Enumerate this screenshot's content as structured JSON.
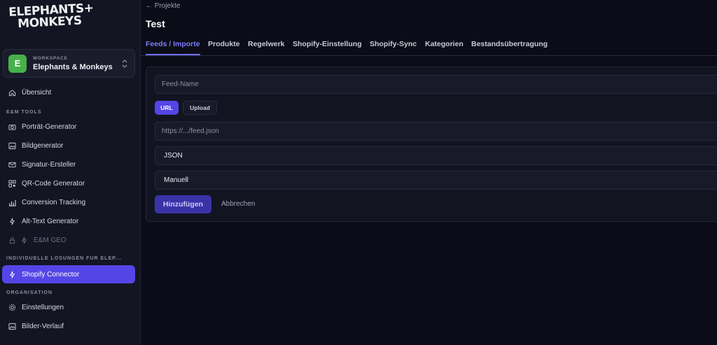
{
  "logo": {
    "line1": "ELEPHANTS+",
    "line2": "MONKEYS"
  },
  "workspace": {
    "avatar": "E",
    "caption": "WORKSPACE",
    "name": "Elephants & Monkeys"
  },
  "sidebar": {
    "overview": "Übersicht",
    "section_tools": "E&M TOOLS",
    "tools": [
      {
        "label": "Porträt-Generator",
        "icon": "camera-icon"
      },
      {
        "label": "Bildgenerator",
        "icon": "image-icon"
      },
      {
        "label": "Signatur-Ersteller",
        "icon": "mail-icon"
      },
      {
        "label": "QR-Code Generator",
        "icon": "qr-code-icon"
      },
      {
        "label": "Conversion Tracking",
        "icon": "bar-chart-icon"
      },
      {
        "label": "Alt-Text Generator",
        "icon": "sparkle-icon"
      },
      {
        "label": "E&M GEO",
        "icon": "sparkle-icon"
      }
    ],
    "section_custom": "INDIVIDUELLE LÖSUNGEN FÜR ELEP...",
    "shopify_connector": "Shopify Connector",
    "section_org": "ORGANISATION",
    "settings": "Einstellungen",
    "image_history": "Bilder-Verlauf"
  },
  "main": {
    "back_link": "← Projekte",
    "title": "Test",
    "tabs": [
      "Feeds / Importe",
      "Produkte",
      "Regelwerk",
      "Shopify-Einstellung",
      "Shopify-Sync",
      "Kategorien",
      "Bestandsübertragung"
    ],
    "form": {
      "feed_name_placeholder": "Feed-Name",
      "source_url": "URL",
      "source_upload": "Upload",
      "url_placeholder": "https://.../feed.json",
      "format_value": "JSON",
      "schedule_value": "Manuell",
      "add_button": "Hinzufügen",
      "cancel_button": "Abbrechen"
    }
  },
  "colors": {
    "accent": "#5446e6",
    "background": "#0b0c17",
    "sidebar": "#141522",
    "avatar": "#46b14a"
  }
}
